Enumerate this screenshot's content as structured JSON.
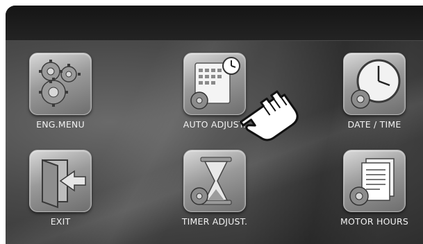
{
  "menu": {
    "items": [
      {
        "id": "eng-menu",
        "label": "ENG.MENU",
        "icon": "gears-icon"
      },
      {
        "id": "auto-adjust",
        "label": "AUTO ADJUST.",
        "icon": "calendar-clock-icon"
      },
      {
        "id": "date-time",
        "label": "DATE / TIME",
        "icon": "clock-icon"
      },
      {
        "id": "exit",
        "label": "EXIT",
        "icon": "exit-door-icon"
      },
      {
        "id": "timer-adjust",
        "label": "TIMER ADJUST.",
        "icon": "hourglass-icon"
      },
      {
        "id": "motor-hours",
        "label": "MOTOR HOURS",
        "icon": "document-icon"
      }
    ]
  },
  "pointer": {
    "icon": "pointing-hand-icon"
  }
}
